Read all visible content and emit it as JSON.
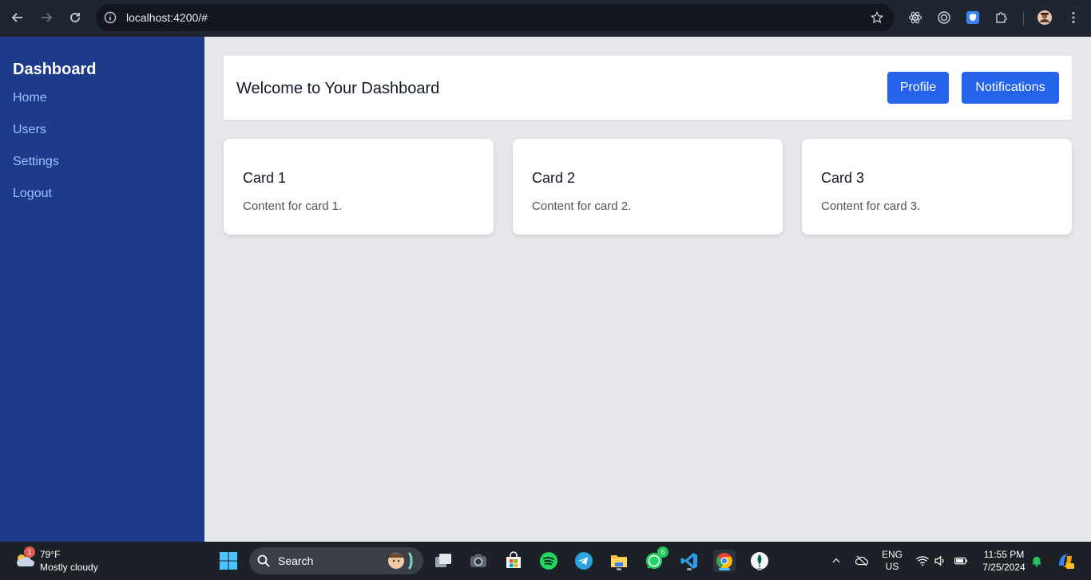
{
  "browser": {
    "url": "localhost:4200/#",
    "icons": {
      "back": "back-arrow-icon",
      "forward": "forward-arrow-icon",
      "reload": "reload-icon",
      "site_info": "site-info-icon",
      "bookmark": "star-icon",
      "extensions": [
        "react-devtools-icon",
        "target-icon",
        "shield-extension-icon",
        "puzzle-icon"
      ],
      "profile": "avatar",
      "menu": "kebab-menu-icon"
    }
  },
  "sidebar": {
    "title": "Dashboard",
    "items": [
      {
        "label": "Home"
      },
      {
        "label": "Users"
      },
      {
        "label": "Settings"
      },
      {
        "label": "Logout"
      }
    ]
  },
  "header": {
    "title": "Welcome to Your Dashboard",
    "buttons": {
      "profile": "Profile",
      "notifications": "Notifications"
    }
  },
  "cards": [
    {
      "title": "Card 1",
      "content": "Content for card 1."
    },
    {
      "title": "Card 2",
      "content": "Content for card 2."
    },
    {
      "title": "Card 3",
      "content": "Content for card 3."
    }
  ],
  "colors": {
    "sidebar_bg": "#1e3a8a",
    "sidebar_link": "#93c5fd",
    "primary_button": "#2563eb",
    "main_bg": "#e5e7eb"
  },
  "taskbar": {
    "weather": {
      "badge": "1",
      "temp": "79°F",
      "condition": "Mostly cloudy"
    },
    "search_label": "Search",
    "whatsapp_badge": "6",
    "language": {
      "line1": "ENG",
      "line2": "US"
    },
    "clock": {
      "time": "11:55 PM",
      "date": "7/25/2024"
    }
  }
}
